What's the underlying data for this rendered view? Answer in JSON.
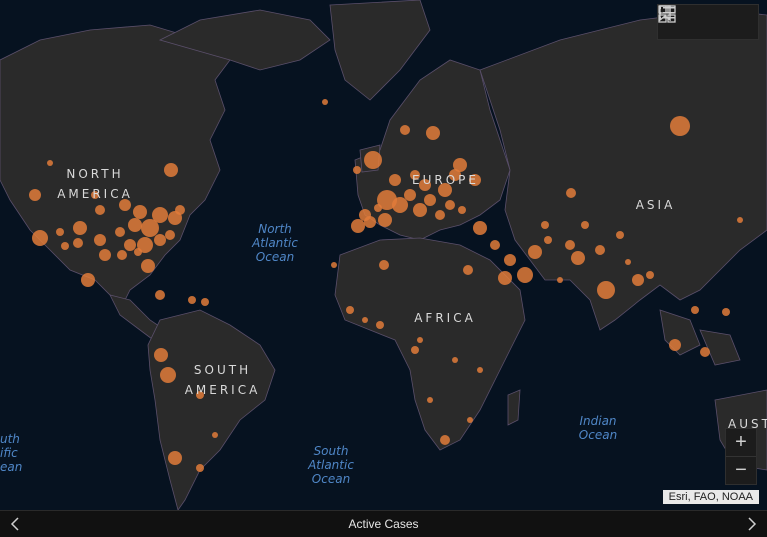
{
  "map": {
    "continents": [
      {
        "id": "north-america",
        "lines": [
          "NORTH",
          "AMERICA"
        ]
      },
      {
        "id": "south-america",
        "lines": [
          "SOUTH",
          "AMERICA"
        ]
      },
      {
        "id": "europe",
        "lines": [
          "EUROPE"
        ]
      },
      {
        "id": "africa",
        "lines": [
          "AFRICA"
        ]
      },
      {
        "id": "asia",
        "lines": [
          "ASIA"
        ]
      },
      {
        "id": "australia",
        "lines": [
          "AUSTI"
        ]
      }
    ],
    "oceans": [
      {
        "id": "north-atlantic",
        "text": "North\nAtlantic\nOcean"
      },
      {
        "id": "south-atlantic",
        "text": "South\nAtlantic\nOcean"
      },
      {
        "id": "indian",
        "text": "Indian\nOcean"
      },
      {
        "id": "south-pacific-partial",
        "text": "uth\nific\nean"
      }
    ],
    "marker_color": "#e07b39",
    "land_color": "#2a2a2a",
    "water_color": "#061220"
  },
  "toolbar": {
    "bookmark_icon": "bookmark-icon",
    "legend_icon": "legend-list-icon",
    "basemap_icon": "basemap-gallery-icon"
  },
  "zoom": {
    "in": "+",
    "out": "−"
  },
  "attribution": "Esri, FAO, NOAA",
  "footer": {
    "title": "Active Cases"
  }
}
